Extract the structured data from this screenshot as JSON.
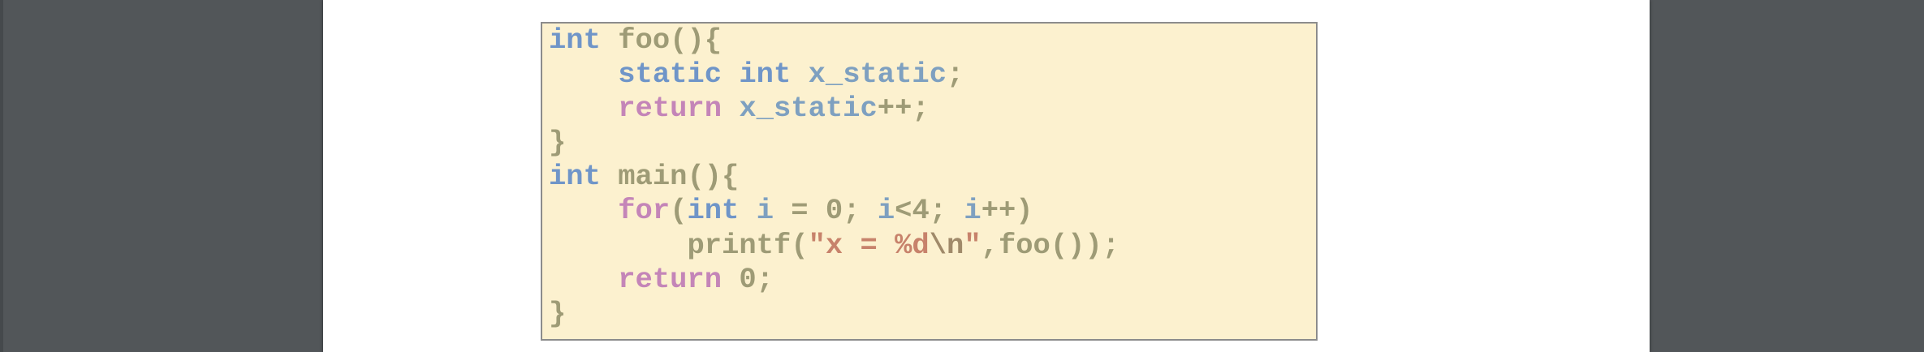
{
  "colors": {
    "viewer_background": "#525659",
    "page_background": "#ffffff",
    "code_background": "#fcf1cf",
    "code_border": "#8c8c8c",
    "keyword": "#6f95c8",
    "control": "#c485b8",
    "identifier": "#9e9b76",
    "variable": "#7ea0c0",
    "string": "#c7826b"
  },
  "code": {
    "language": "c",
    "lines": [
      {
        "tokens": [
          {
            "t": "int",
            "k": "keyword"
          },
          {
            "t": " ",
            "k": "plain"
          },
          {
            "t": "foo",
            "k": "ident"
          },
          {
            "t": "(){",
            "k": "punct"
          }
        ]
      },
      {
        "tokens": [
          {
            "t": "    ",
            "k": "plain"
          },
          {
            "t": "static",
            "k": "keyword"
          },
          {
            "t": " ",
            "k": "plain"
          },
          {
            "t": "int",
            "k": "keyword"
          },
          {
            "t": " ",
            "k": "plain"
          },
          {
            "t": "x_static",
            "k": "var"
          },
          {
            "t": ";",
            "k": "punct"
          }
        ]
      },
      {
        "tokens": [
          {
            "t": "    ",
            "k": "plain"
          },
          {
            "t": "return",
            "k": "control"
          },
          {
            "t": " ",
            "k": "plain"
          },
          {
            "t": "x_static",
            "k": "var"
          },
          {
            "t": "++;",
            "k": "punct"
          }
        ]
      },
      {
        "tokens": [
          {
            "t": "}",
            "k": "punct"
          }
        ]
      },
      {
        "tokens": [
          {
            "t": "int",
            "k": "keyword"
          },
          {
            "t": " ",
            "k": "plain"
          },
          {
            "t": "main",
            "k": "ident"
          },
          {
            "t": "(){",
            "k": "punct"
          }
        ]
      },
      {
        "tokens": [
          {
            "t": "    ",
            "k": "plain"
          },
          {
            "t": "for",
            "k": "control"
          },
          {
            "t": "(",
            "k": "punct"
          },
          {
            "t": "int",
            "k": "keyword"
          },
          {
            "t": " ",
            "k": "plain"
          },
          {
            "t": "i",
            "k": "var"
          },
          {
            "t": " = ",
            "k": "punct"
          },
          {
            "t": "0",
            "k": "number"
          },
          {
            "t": "; ",
            "k": "punct"
          },
          {
            "t": "i",
            "k": "var"
          },
          {
            "t": "<",
            "k": "punct"
          },
          {
            "t": "4",
            "k": "number"
          },
          {
            "t": "; ",
            "k": "punct"
          },
          {
            "t": "i",
            "k": "var"
          },
          {
            "t": "++)",
            "k": "punct"
          }
        ]
      },
      {
        "tokens": [
          {
            "t": "        ",
            "k": "plain"
          },
          {
            "t": "printf",
            "k": "ident"
          },
          {
            "t": "(",
            "k": "punct"
          },
          {
            "t": "\"x = %d",
            "k": "string"
          },
          {
            "t": "\\n",
            "k": "escape"
          },
          {
            "t": "\"",
            "k": "string"
          },
          {
            "t": ",",
            "k": "punct"
          },
          {
            "t": "foo",
            "k": "ident"
          },
          {
            "t": "());",
            "k": "punct"
          }
        ]
      },
      {
        "tokens": [
          {
            "t": "    ",
            "k": "plain"
          },
          {
            "t": "return",
            "k": "control"
          },
          {
            "t": " ",
            "k": "plain"
          },
          {
            "t": "0",
            "k": "number"
          },
          {
            "t": ";",
            "k": "punct"
          }
        ]
      },
      {
        "tokens": [
          {
            "t": "}",
            "k": "punct"
          }
        ]
      }
    ]
  }
}
